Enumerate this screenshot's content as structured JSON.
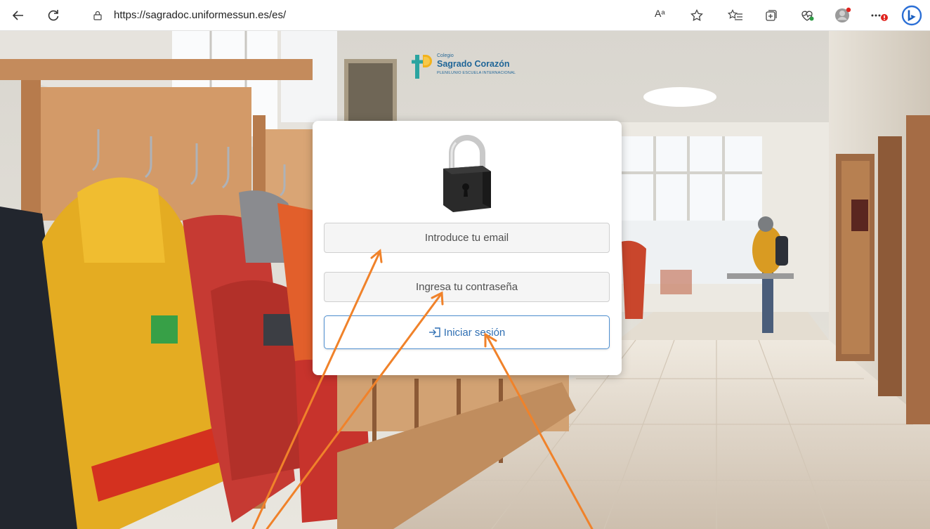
{
  "browser": {
    "url": "https://sagradoc.uniformessun.es/es/",
    "read_aloud_label": "Aᵃ",
    "icons": {
      "back": "back-arrow-icon",
      "refresh": "refresh-icon",
      "lock": "lock-icon",
      "read_aloud": "read-aloud-icon",
      "favorite": "star-icon",
      "favorites_list": "favorites-list-icon",
      "collections": "collections-icon",
      "health": "browser-essentials-icon",
      "profile": "profile-avatar-icon",
      "more": "more-options-icon",
      "bing": "bing-icon"
    },
    "colors": {
      "bing": "#1a73c8",
      "badge": "#e0241f"
    }
  },
  "logo": {
    "line1": "Colegio",
    "line2": "Sagrado Corazón",
    "line3": "PLENILUNIO ESCUELA INTERNACIONAL"
  },
  "login": {
    "email_placeholder": "Introduce tu email",
    "password_placeholder": "Ingresa tu contraseña",
    "submit_label": "Iniciar sesión",
    "icons": {
      "padlock": "padlock-icon",
      "submit": "login-icon"
    },
    "colors": {
      "accent": "#2f6fb3",
      "annotation": "#f0822a"
    }
  }
}
